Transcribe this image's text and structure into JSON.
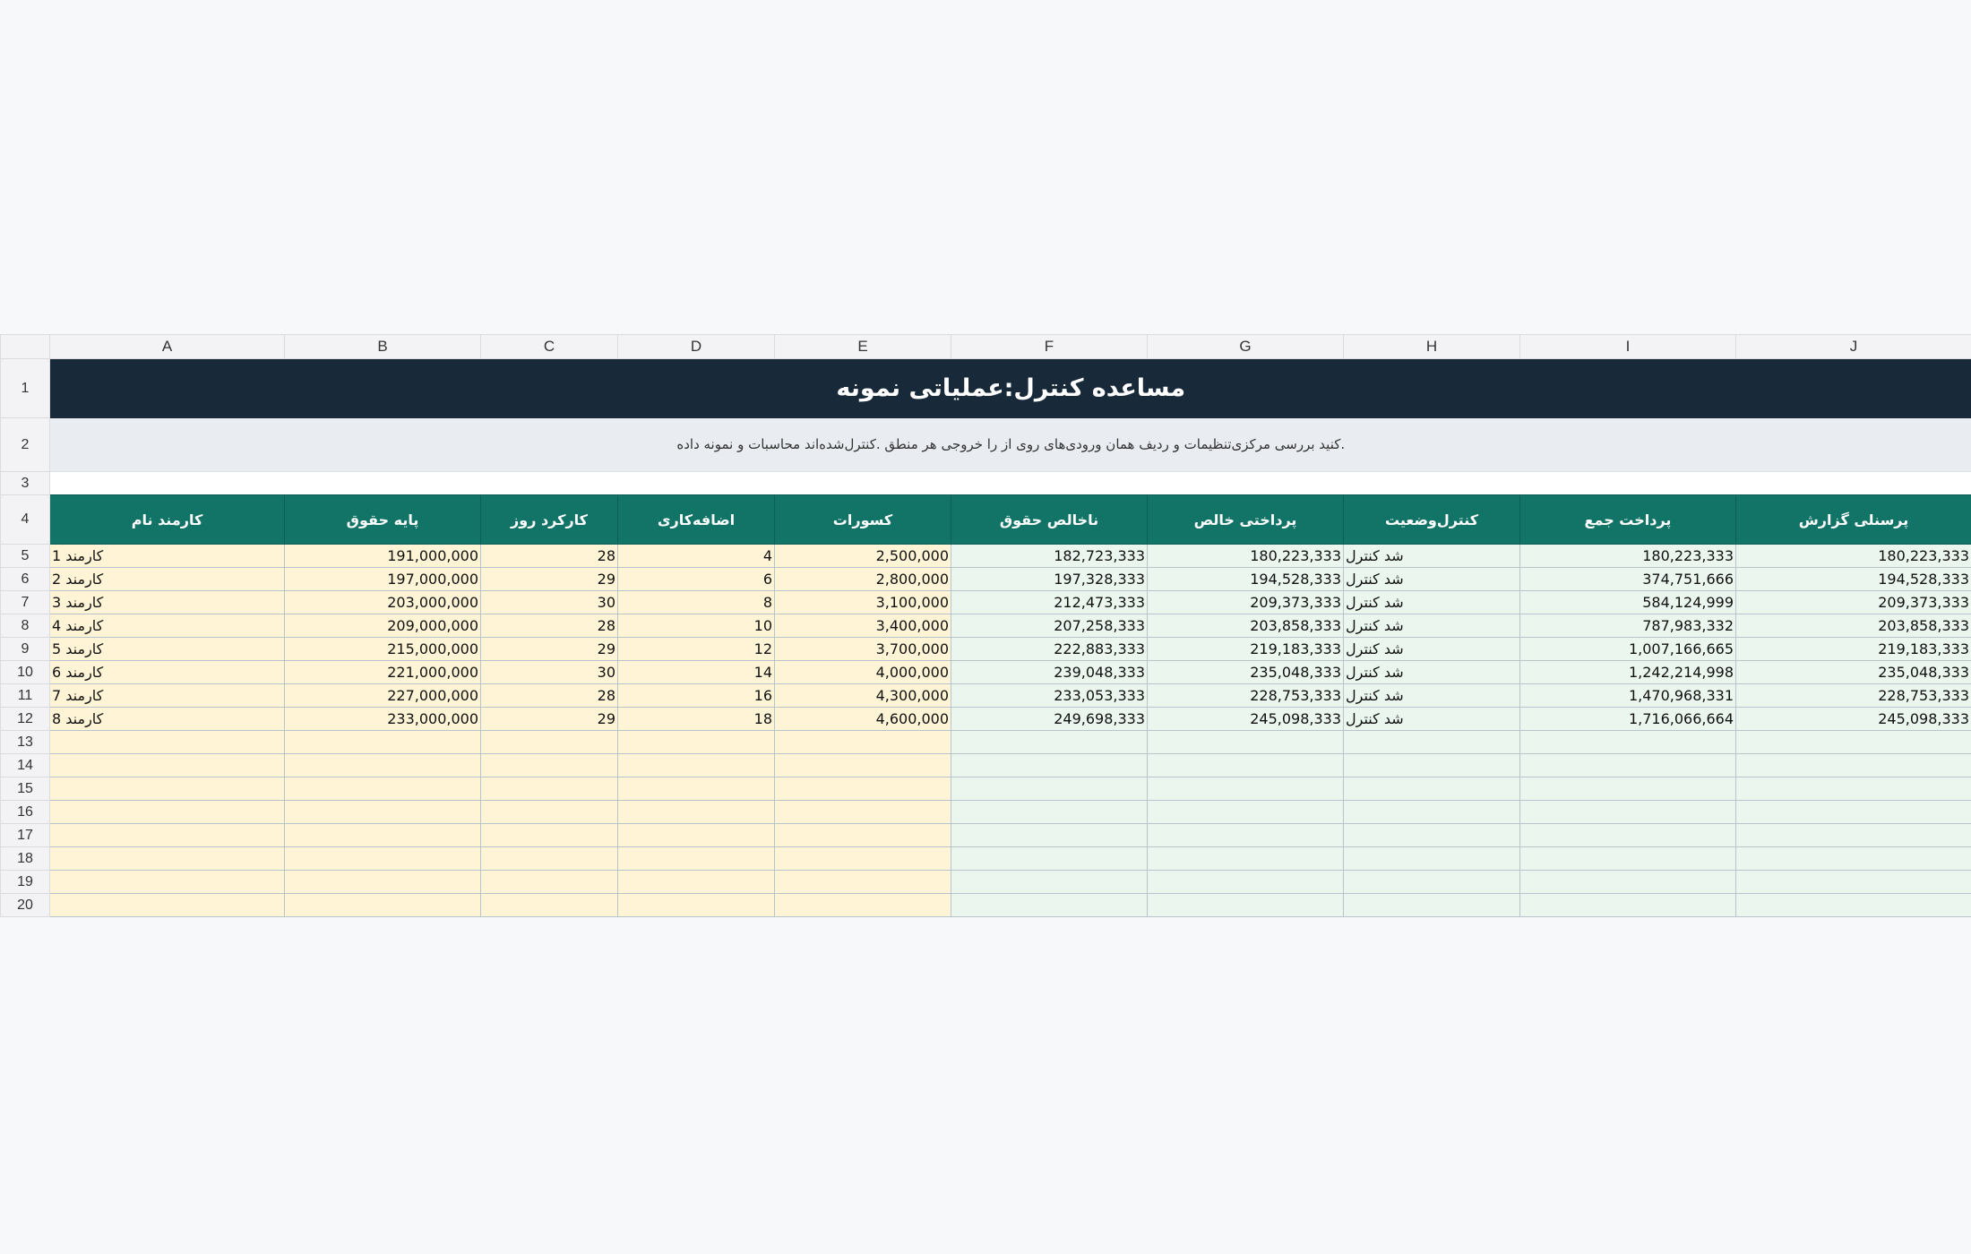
{
  "columns": [
    "A",
    "B",
    "C",
    "D",
    "E",
    "F",
    "G",
    "H",
    "I",
    "J"
  ],
  "title": "مساعده کنترل:عملیاتی نمونه",
  "description": ".کنید بررسی مرکزی‌تنظیمات و ردیف همان ورودی‌های روی از را خروجی هر منطق .کنترل‌شده‌اند محاسبات و نمونه داده",
  "headers": [
    "کارمند نام",
    "پایه حقوق",
    "کارکرد روز",
    "اضافه‌کاری",
    "کسورات",
    "ناخالص حقوق",
    "پرداختی خالص",
    "کنترل‌وضعیت",
    "پرداخت جمع",
    "پرسنلی گزارش"
  ],
  "rows": [
    [
      "کارمند 1",
      "191,000,000",
      "28",
      "4",
      "2,500,000",
      "182,723,333",
      "180,223,333",
      "شد کنترل",
      "180,223,333",
      "180,223,333"
    ],
    [
      "کارمند 2",
      "197,000,000",
      "29",
      "6",
      "2,800,000",
      "197,328,333",
      "194,528,333",
      "شد کنترل",
      "374,751,666",
      "194,528,333"
    ],
    [
      "کارمند 3",
      "203,000,000",
      "30",
      "8",
      "3,100,000",
      "212,473,333",
      "209,373,333",
      "شد کنترل",
      "584,124,999",
      "209,373,333"
    ],
    [
      "کارمند 4",
      "209,000,000",
      "28",
      "10",
      "3,400,000",
      "207,258,333",
      "203,858,333",
      "شد کنترل",
      "787,983,332",
      "203,858,333"
    ],
    [
      "کارمند 5",
      "215,000,000",
      "29",
      "12",
      "3,700,000",
      "222,883,333",
      "219,183,333",
      "شد کنترل",
      "1,007,166,665",
      "219,183,333"
    ],
    [
      "کارمند 6",
      "221,000,000",
      "30",
      "14",
      "4,000,000",
      "239,048,333",
      "235,048,333",
      "شد کنترل",
      "1,242,214,998",
      "235,048,333"
    ],
    [
      "کارمند 7",
      "227,000,000",
      "28",
      "16",
      "4,300,000",
      "233,053,333",
      "228,753,333",
      "شد کنترل",
      "1,470,968,331",
      "228,753,333"
    ],
    [
      "کارمند 8",
      "233,000,000",
      "29",
      "18",
      "4,600,000",
      "249,698,333",
      "245,098,333",
      "شد کنترل",
      "1,716,066,664",
      "245,098,333"
    ]
  ],
  "row_numbers": [
    "1",
    "2",
    "3",
    "4",
    "5",
    "6",
    "7",
    "8",
    "9",
    "10",
    "11",
    "12",
    "13",
    "14",
    "15",
    "16",
    "17",
    "18",
    "19",
    "20"
  ],
  "colors": {
    "title_bg": "#182a3a",
    "header_bg": "#127467",
    "input_bg": "#fff5d6",
    "output_bg": "#eaf6ee"
  }
}
